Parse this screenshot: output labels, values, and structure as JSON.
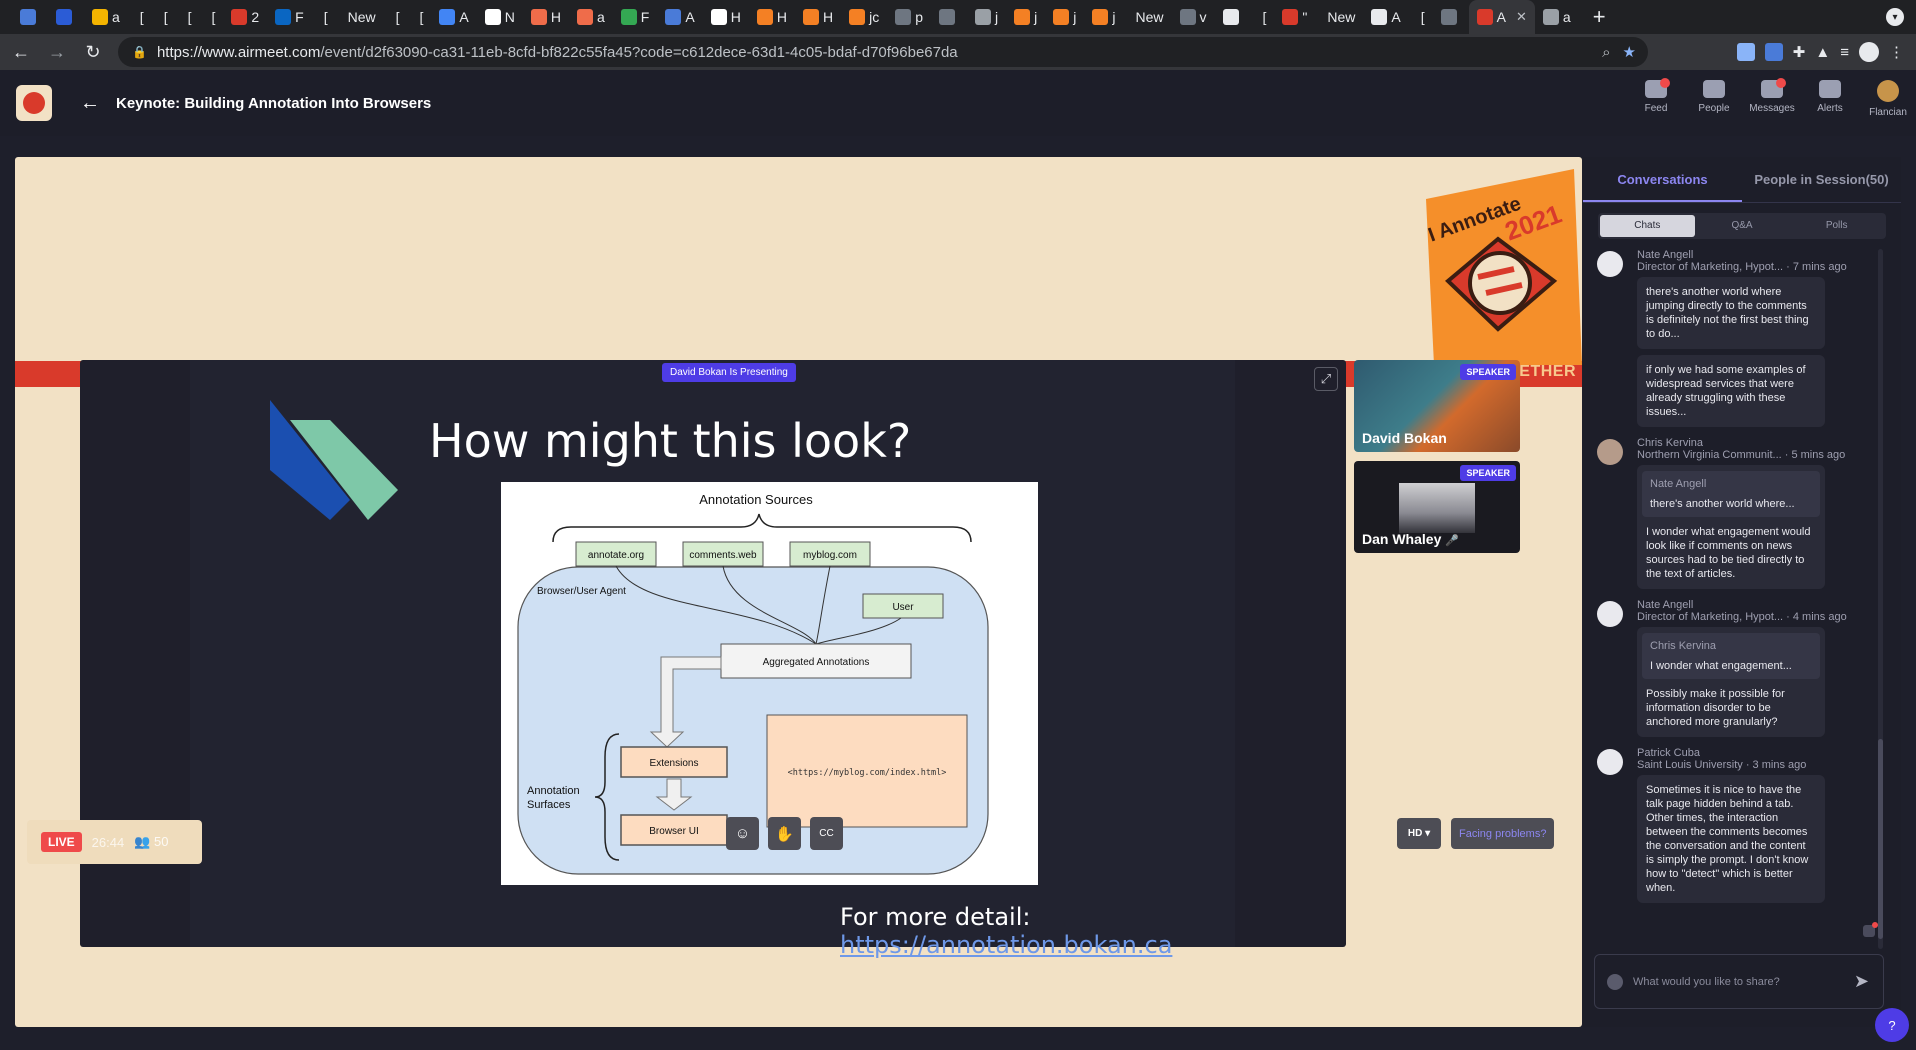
{
  "browser": {
    "tabs": [
      {
        "label": "",
        "color": "#4a7bd8"
      },
      {
        "label": "",
        "color": "#2b5cd6"
      },
      {
        "label": "a",
        "color": "#f4b400"
      },
      {
        "label": "[",
        "color": ""
      },
      {
        "label": "[",
        "color": ""
      },
      {
        "label": "[",
        "color": ""
      },
      {
        "label": "[",
        "color": ""
      },
      {
        "label": "2",
        "color": "#d93a2b"
      },
      {
        "label": "F",
        "color": "#0a66c2"
      },
      {
        "label": "[",
        "color": ""
      },
      {
        "label": "New",
        "color": ""
      },
      {
        "label": "[",
        "color": ""
      },
      {
        "label": "[",
        "color": ""
      },
      {
        "label": "A",
        "color": "#4285f4"
      },
      {
        "label": "N",
        "color": "#ffffff"
      },
      {
        "label": "H",
        "color": "#ef6c4a"
      },
      {
        "label": "a",
        "color": "#ef6c4a"
      },
      {
        "label": "F",
        "color": "#34a853"
      },
      {
        "label": "A",
        "color": "#4a7bd8"
      },
      {
        "label": "H",
        "color": "#ffffff"
      },
      {
        "label": "H",
        "color": "#f48024"
      },
      {
        "label": "H",
        "color": "#f48024"
      },
      {
        "label": "jc",
        "color": "#f48024"
      },
      {
        "label": "p",
        "color": "#6e7681"
      },
      {
        "label": "",
        "color": "#6e7681"
      },
      {
        "label": "j",
        "color": "#9aa0a6"
      },
      {
        "label": "j",
        "color": "#f48024"
      },
      {
        "label": "j",
        "color": "#f48024"
      },
      {
        "label": "j",
        "color": "#f48024"
      },
      {
        "label": "New",
        "color": ""
      },
      {
        "label": "v",
        "color": "#6e7681"
      },
      {
        "label": "",
        "color": "#e8eaed"
      },
      {
        "label": "[",
        "color": ""
      },
      {
        "label": "\"",
        "color": "#d93a2b"
      },
      {
        "label": "New",
        "color": ""
      },
      {
        "label": "A",
        "color": "#e8eaed"
      },
      {
        "label": "[",
        "color": ""
      },
      {
        "label": "",
        "color": "#6e7681"
      }
    ],
    "active_tab": {
      "label": "A",
      "color": "#d93a2b"
    },
    "trailing_tab": {
      "label": "a",
      "color": "#9aa0a6"
    },
    "url_host": "https://www.airmeet.com",
    "url_path": "/event/d2f63090-ca31-11eb-8cfd-bf822c55fa45?code=c612dece-63d1-4c05-bdaf-d70f96be67da"
  },
  "header": {
    "title": "Keynote: Building Annotation Into Browsers",
    "nav": [
      {
        "label": "Feed",
        "dot": true
      },
      {
        "label": "People",
        "dot": false
      },
      {
        "label": "Messages",
        "dot": true
      },
      {
        "label": "Alerts",
        "dot": false
      },
      {
        "label": "Flancian",
        "dot": false
      }
    ]
  },
  "stage": {
    "banner_text": "GETHER",
    "logo_text": "I Annotate 2021",
    "presenting": "David Bokan Is Presenting",
    "slide": {
      "title": "How might this look?",
      "diagram": {
        "sources_title": "Annotation Sources",
        "sources": [
          "annotate.org",
          "comments.web",
          "myblog.com"
        ],
        "agent_label": "Browser/User Agent",
        "user": "User",
        "aggregated": "Aggregated Annotations",
        "surfaces_label_1": "Annotation",
        "surfaces_label_2": "Surfaces",
        "extensions": "Extensions",
        "browser_ui": "Browser UI",
        "page_url": "<https://myblog.com/index.html>"
      },
      "more_detail": "For more detail: ",
      "more_link": "https://annotation.bokan.ca"
    },
    "speakers": [
      {
        "name": "David Bokan",
        "badge": "SPEAKER"
      },
      {
        "name": "Dan Whaley",
        "badge": "SPEAKER"
      }
    ],
    "controls": {
      "live": "LIVE",
      "timer": "26:44",
      "attendees": "50",
      "hd": "HD",
      "facing": "Facing problems?"
    }
  },
  "sidebar": {
    "tabs": [
      "Conversations",
      "People in Session(50)"
    ],
    "subtabs": [
      "Chats",
      "Q&A",
      "Polls"
    ],
    "messages": [
      {
        "author": "Nate Angell",
        "meta": "Director of Marketing, Hypot... · 7 mins ago",
        "bubbles": [
          "there's another world where jumping directly to the comments is definitely not the first best thing to do...",
          "if only we had some examples of widespread services that were already struggling with these issues..."
        ]
      },
      {
        "author": "Chris Kervina",
        "meta": "Northern Virginia Communit... · 5 mins ago",
        "quote_author": "Nate Angell",
        "quote_text": "there's another world where...",
        "text": "I wonder what engagement would look like if comments on news sources had to be tied directly to the text of articles."
      },
      {
        "author": "Nate Angell",
        "meta": "Director of Marketing, Hypot... · 4 mins ago",
        "quote_author": "Chris Kervina",
        "quote_text": "I wonder what engagement...",
        "text": "Possibly make it possible for information disorder to be anchored more granularly?"
      },
      {
        "author": "Patrick Cuba",
        "meta": "Saint Louis University · 3 mins ago",
        "text": "Sometimes it is nice to have the talk page hidden behind a tab. Other times, the interaction between the comments becomes the conversation and the content is simply the prompt. I don't know how to \"detect\" which is better when."
      }
    ],
    "compose_placeholder": "What would you like to share?"
  },
  "colors": {
    "accent": "#4e3ce6",
    "live": "#ef4a4a",
    "stage_bg": "#f2e1c5",
    "banner": "#d93a2b"
  }
}
